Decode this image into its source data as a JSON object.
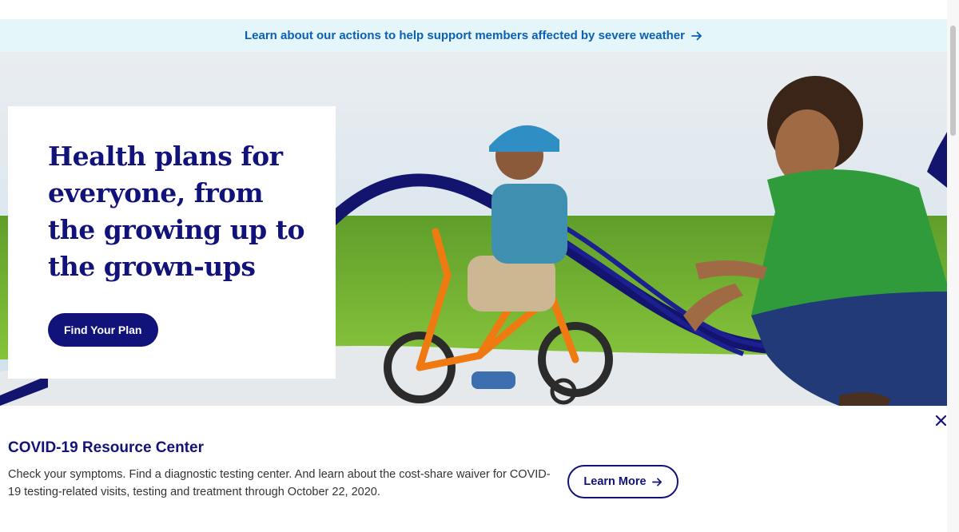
{
  "alert": {
    "text": "Learn about our actions to help support members affected by severe weather",
    "icon": "arrow-right-icon"
  },
  "hero": {
    "title": "Health plans for everyone, from the growing up to the grown-ups",
    "cta_label": "Find Your Plan",
    "image_desc_icon": "hero-photo"
  },
  "covid": {
    "title": "COVID-19 Resource Center",
    "body": "Check your symptoms. Find a diagnostic testing center. And learn about the cost-share waiver for COVID-19 testing-related visits, testing and treatment through October 22, 2020.",
    "button_label": "Learn More",
    "close_icon": "close-icon"
  },
  "colors": {
    "navy": "#12137a",
    "alert_bg": "#e4f6fa",
    "alert_link": "#0b5fb4"
  }
}
